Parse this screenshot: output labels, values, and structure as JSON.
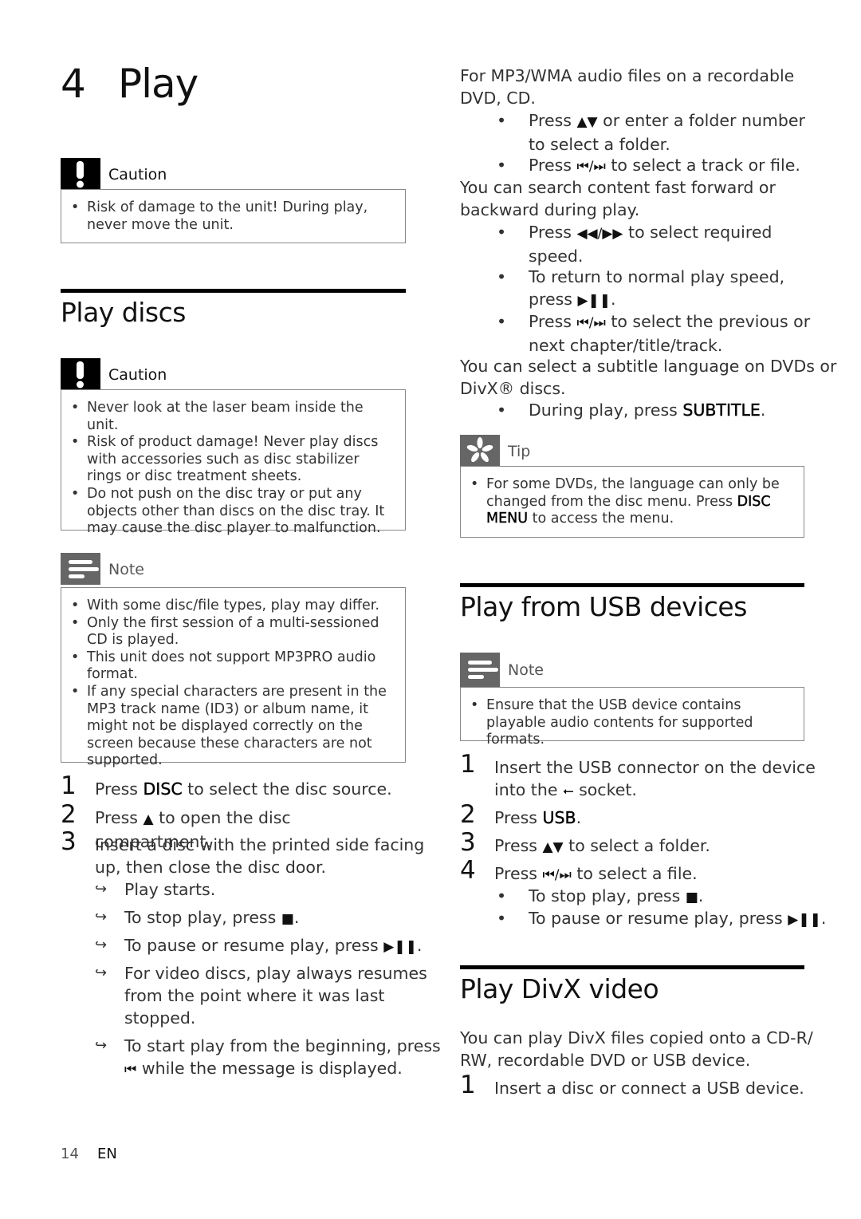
{
  "chapter": {
    "number": "4",
    "title": "Play"
  },
  "intro_caution": {
    "label": "Caution",
    "icon": "exclamation-icon",
    "items": [
      "Risk of damage to the unit! During play, never move the unit."
    ]
  },
  "play_discs": {
    "title": "Play discs",
    "caution": {
      "label": "Caution",
      "icon": "exclamation-icon",
      "items": [
        "Never look at the laser beam inside the unit.",
        "Risk of product damage! Never play discs with accessories such as disc stabilizer rings or disc treatment sheets.",
        "Do not push on the disc tray or put any objects other than discs on the disc tray. It may cause the disc player to malfunction."
      ]
    },
    "note": {
      "label": "Note",
      "icon": "note-lines-icon",
      "items": [
        "With some disc/file types, play may differ.",
        "Only the first session of a multi-sessioned CD is played.",
        "This unit does not support MP3PRO audio format.",
        "If any special characters are present in the MP3 track name (ID3) or album name, it might not be displayed correctly on the screen because these characters are not supported."
      ]
    },
    "steps": [
      {
        "num": "1",
        "pre": "Press ",
        "key": "DISC",
        "post": " to select the disc source."
      },
      {
        "num": "2",
        "pre": "Press ",
        "sym": "▲",
        "post": " to open the disc compartment."
      },
      {
        "num": "3",
        "line1": "Insert a disc with the printed side facing",
        "line2": "up, then close the disc door."
      }
    ],
    "results": [
      {
        "text": "Play starts."
      },
      {
        "text": "To stop play, press ",
        "sym": "■",
        "post": "."
      },
      {
        "text": "To pause or resume play, press ",
        "sym": "▶❚❚",
        "post": "."
      },
      {
        "line1": "For video discs, play always resumes",
        "line2": "from the point where it was last",
        "line3": "stopped."
      },
      {
        "line1": "To start play from the beginning, press",
        "sym": "⏮",
        "line2": " while the message is displayed."
      }
    ]
  },
  "mp3": {
    "intro_line1": "For MP3/WMA audio files on a recordable",
    "intro_line2": "DVD, CD.",
    "bullets_a": [
      {
        "pre": "Press ",
        "sym": "▲▼",
        "line1": " or enter a folder number",
        "line2": "to select a folder."
      },
      {
        "pre": "Press ",
        "sym": "⏮/⏭",
        "line1": " to select a track or file."
      }
    ],
    "search_line1": "You can search content fast forward or",
    "search_line2": "backward during play.",
    "bullets_b": [
      {
        "pre": "Press ",
        "sym": "◀◀/▶▶",
        "line1": " to select required",
        "line2": "speed."
      },
      {
        "line1": "To return to normal play speed,",
        "line2pre": "press ",
        "sym": "▶❚❚",
        "line2post": "."
      },
      {
        "pre": "Press ",
        "sym": "⏮/⏭",
        "line1": " to select the previous or",
        "line2": "next chapter/title/track."
      }
    ],
    "subtitle_line1": "You can select a subtitle language on DVDs or",
    "subtitle_line2": "DivX® discs.",
    "subtitle_bullet": {
      "pre": "During play, press ",
      "key": "SUBTITLE",
      "post": "."
    }
  },
  "tip": {
    "label": "Tip",
    "icon": "asterisk-tip-icon",
    "line1": "For some DVDs, the language can only be",
    "line2pre": "changed from the disc menu. Press ",
    "key1": "DISC",
    "key2": "MENU",
    "line3post": " to access the menu."
  },
  "usb": {
    "title": "Play from USB devices",
    "note": {
      "label": "Note",
      "icon": "note-lines-icon",
      "items": [
        "Ensure that the USB device contains playable audio contents for supported formats."
      ]
    },
    "steps": [
      {
        "num": "1",
        "line1": "Insert the USB connector on the device",
        "line2pre": "into the ",
        "sym": "⭠",
        "line2post": " socket."
      },
      {
        "num": "2",
        "pre": "Press ",
        "key": "USB",
        "post": "."
      },
      {
        "num": "3",
        "pre": "Press ",
        "sym": "▲▼",
        "post": " to select a folder."
      },
      {
        "num": "4",
        "pre": "Press ",
        "sym": "⏮/⏭",
        "post": " to select a file."
      }
    ],
    "bullets": [
      {
        "pre": "To stop play, press ",
        "sym": "■",
        "post": "."
      },
      {
        "pre": "To pause or resume play, press ",
        "sym": "▶❚❚",
        "post": "."
      }
    ]
  },
  "divx": {
    "title": "Play DivX video",
    "intro_line1": "You can play DivX files copied onto a CD-R/",
    "intro_line2": "RW, recordable DVD or USB device.",
    "steps": [
      {
        "num": "1",
        "text": "Insert a disc or connect a USB device."
      }
    ]
  },
  "footer": {
    "page": "14",
    "lang": "EN"
  }
}
